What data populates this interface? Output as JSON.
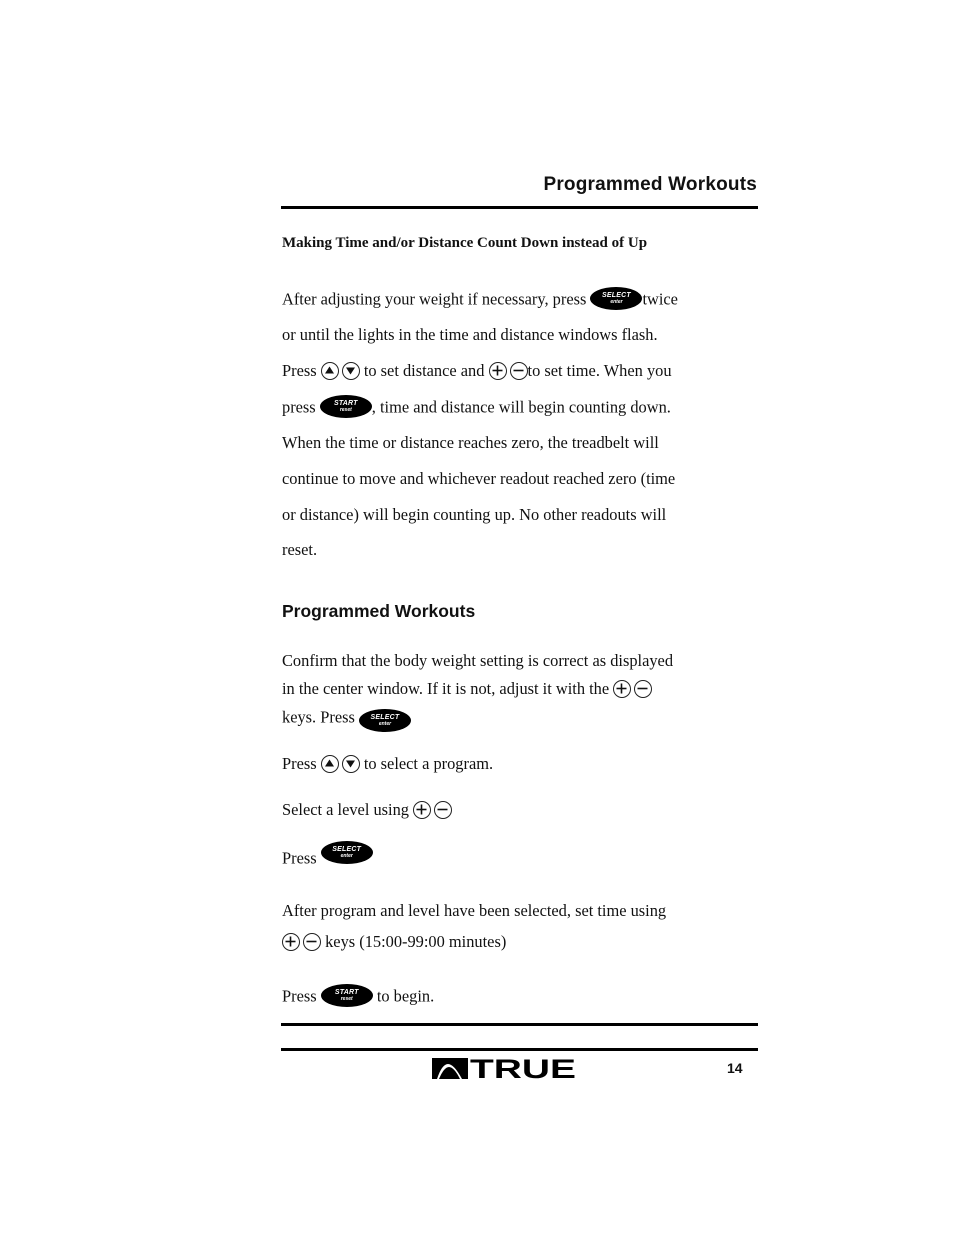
{
  "header": {
    "title": "Programmed Workouts"
  },
  "section1": {
    "subheading": "Making Time and/or Distance Count Down instead of Up",
    "lines": [
      {
        "before": "After adjusting your weight if necessary, press ",
        "after": "twice"
      },
      {
        "text": "or until the lights in the time and distance windows flash."
      },
      {
        "before": "Press ",
        "middle": " to set distance and ",
        "after": "to set time.  When you"
      },
      {
        "before": "press ",
        "after": ", time and distance will begin counting down."
      },
      {
        "text": "When the time or distance reaches zero, the treadbelt will"
      },
      {
        "text": "continue to move and whichever readout reached zero (time"
      },
      {
        "text": "or distance) will begin counting up. No other readouts will"
      },
      {
        "text": "reset."
      }
    ]
  },
  "section2": {
    "heading": "Programmed Workouts",
    "para1": {
      "line1": "Confirm that the body weight setting is correct as displayed",
      "line2": "in the center window. If it is not, adjust it with the ",
      "line3": "keys.  Press "
    },
    "para2": {
      "before": "Press ",
      "after": " to select a program."
    },
    "para3": {
      "before": "Select a level using "
    },
    "para4": {
      "before": "Press "
    },
    "para5": {
      "line1": "After program and level have been selected, set time using",
      "line2_after": " keys (15:00-99:00 minutes)"
    },
    "para6": {
      "before": "Press ",
      "after": " to begin."
    }
  },
  "buttons": {
    "select": {
      "top": "SELECT",
      "bottom": "enter"
    },
    "start": {
      "top": "START",
      "bottom": "reset"
    }
  },
  "icons": {
    "up": "up-arrow-icon",
    "down": "down-arrow-icon",
    "plus": "plus-icon",
    "minus": "minus-icon"
  },
  "footer": {
    "logo_text": "TRUE",
    "page_number": "14"
  }
}
